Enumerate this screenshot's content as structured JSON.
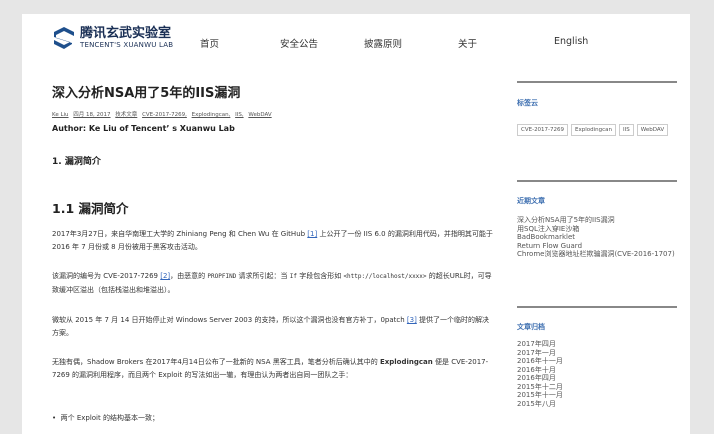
{
  "header": {
    "logo_cn": "腾讯玄武实验室",
    "logo_en": "TENCENT'S XUANWU LAB",
    "nav": [
      "首页",
      "安全公告",
      "披露原则",
      "关于",
      "English"
    ]
  },
  "post": {
    "title": "深入分析NSA用了5年的IIS漏洞",
    "meta": [
      "Ke Liu",
      "四月 18, 2017",
      "技术文章",
      "CVE-2017-7269,",
      "Explodingcan,",
      "IIS,",
      "WebDAV"
    ],
    "author": "Author: Ke Liu of Tencent’ s Xuanwu Lab",
    "section_h4": "1. 漏洞简介",
    "section_h2": "1.1 漏洞简介",
    "p1_a": "2017年3月27日，来自华南理工大学的 Zhiniang Peng 和 Chen Wu 在 GitHub ",
    "p1_ref": "[1]",
    "p1_b": " 上公开了一份 IIS 6.0 的漏洞利用代码，并指明其可能于 2016 年 7 月份或 8 月份被用于黑客攻击活动。",
    "p2_a": "该漏洞的编号为 CVE-2017-7269 ",
    "p2_ref": "[2]",
    "p2_b": "，由恶意的 ",
    "p2_code1": "PROPFIND",
    "p2_c": " 请求所引起：当 ",
    "p2_code2": "If",
    "p2_d": " 字段包含形如 ",
    "p2_code3": "<http://localhost/xxxx>",
    "p2_e": " 的超长URL时，可导致缓冲区溢出（包括栈溢出和堆溢出）。",
    "p3_a": "微软从 2015 年 7 月 14 日开始停止对 Windows Server 2003 的支持，所以这个漏洞也没有官方补丁，0patch ",
    "p3_ref": "[3]",
    "p3_b": " 提供了一个临时的解决方案。",
    "p4_a": "无独有偶，Shadow Brokers 在2017年4月14日公布了一批新的 NSA 黑客工具，笔者分析后确认其中的 ",
    "p4_bold": "Explodingcan",
    "p4_b": " 便是 CVE-2017-7269 的漏洞利用程序，而且两个 Exploit 的写法如出一辙，有理由认为两者出自同一团队之手：",
    "bullet": "两个 Exploit 的结构基本一致；"
  },
  "sidebar": {
    "tags_title": "标签云",
    "tags": [
      "CVE-2017-7269",
      "Explodingcan",
      "IIS",
      "WebDAV"
    ],
    "recent_title": "近期文章",
    "recent": [
      "深入分析NSA用了5年的IIS漏洞",
      "用SQL注入穿IE沙箱",
      "BadBookmarklet",
      "Return Flow Guard",
      "Chrome浏览器地址栏欺骗漏洞(CVE-2016-1707)"
    ],
    "archive_title": "文章归档",
    "archive": [
      "2017年四月",
      "2017年一月",
      "2016年十一月",
      "2016年十月",
      "2016年四月",
      "2015年十二月",
      "2015年十一月",
      "2015年八月"
    ]
  }
}
